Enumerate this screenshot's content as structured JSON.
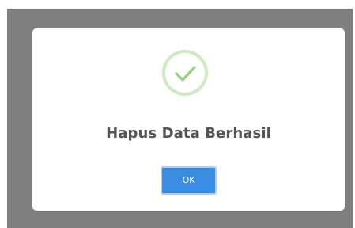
{
  "dialog": {
    "icon": "success-checkmark-icon",
    "title": "Hapus Data Berhasil",
    "ok_label": "OK"
  },
  "colors": {
    "overlay": "#7f7f7f",
    "dialog_bg": "#ffffff",
    "check": "#8fd27a",
    "check_ring": "#cfe9c2",
    "button": "#3b8de3",
    "title_text": "#545454"
  }
}
